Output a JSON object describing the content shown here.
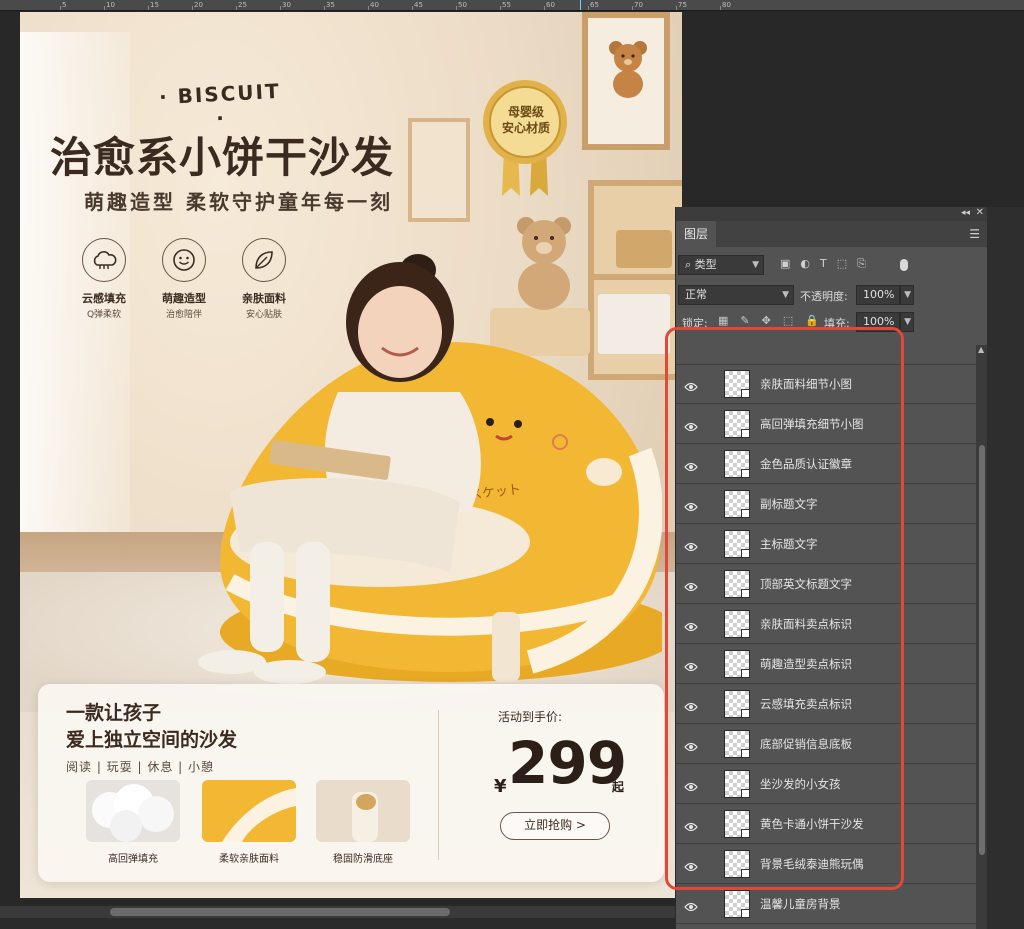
{
  "ruler": {
    "labels": [
      "5",
      "10",
      "15",
      "20",
      "25",
      "30",
      "35",
      "40",
      "45",
      "50",
      "55",
      "60",
      "65",
      "70",
      "75",
      "80"
    ]
  },
  "poster": {
    "brand_en": "· BISCUIT ·",
    "title_main": "治愈系小饼干沙发",
    "title_sub": "萌趣造型 柔软守护童年每一刻",
    "badge": {
      "line1": "母婴级",
      "line2": "安心材质"
    },
    "features": [
      {
        "title": "云感填充",
        "sub": "Q弹柔软",
        "icon": "cloud-icon"
      },
      {
        "title": "萌趣造型",
        "sub": "治愈陪伴",
        "icon": "smiley-icon"
      },
      {
        "title": "亲肤面料",
        "sub": "安心贴肤",
        "icon": "leaf-icon"
      }
    ],
    "sofa_label": "ビスケット",
    "promo": {
      "title_line1": "一款让孩子",
      "title_line2": "爱上独立空间的沙发",
      "tags": "阅读 | 玩耍 | 休息 | 小憩",
      "thumbs": [
        {
          "caption": "高回弹填充"
        },
        {
          "caption": "柔软亲肤面料"
        },
        {
          "caption": "稳固防滑底座"
        }
      ],
      "price_label": "活动到手价:",
      "currency": "¥",
      "price": "299",
      "price_unit": "起",
      "buy_button": "立即抢购 >"
    }
  },
  "layers_panel": {
    "tab": "图层",
    "filter_type": "类型",
    "blend_mode": "正常",
    "opacity_label": "不透明度:",
    "opacity_value": "100%",
    "lock_label": "锁定:",
    "fill_label": "填充:",
    "fill_value": "100%",
    "layers": [
      {
        "name": "亲肤面料细节小图"
      },
      {
        "name": "高回弹填充细节小图"
      },
      {
        "name": "金色品质认证徽章"
      },
      {
        "name": "副标题文字"
      },
      {
        "name": "主标题文字"
      },
      {
        "name": "顶部英文标题文字"
      },
      {
        "name": "亲肤面料卖点标识"
      },
      {
        "name": "萌趣造型卖点标识"
      },
      {
        "name": "云感填充卖点标识"
      },
      {
        "name": "底部促销信息底板"
      },
      {
        "name": "坐沙发的小女孩"
      },
      {
        "name": "黄色卡通小饼干沙发"
      },
      {
        "name": "背景毛绒泰迪熊玩偶"
      },
      {
        "name": "温馨儿童房背景"
      }
    ]
  },
  "colors": {
    "annotation": "#e0483a",
    "panel_bg": "#535353",
    "sofa_yellow": "#f2b834",
    "title_brown": "#3b2a1f"
  }
}
